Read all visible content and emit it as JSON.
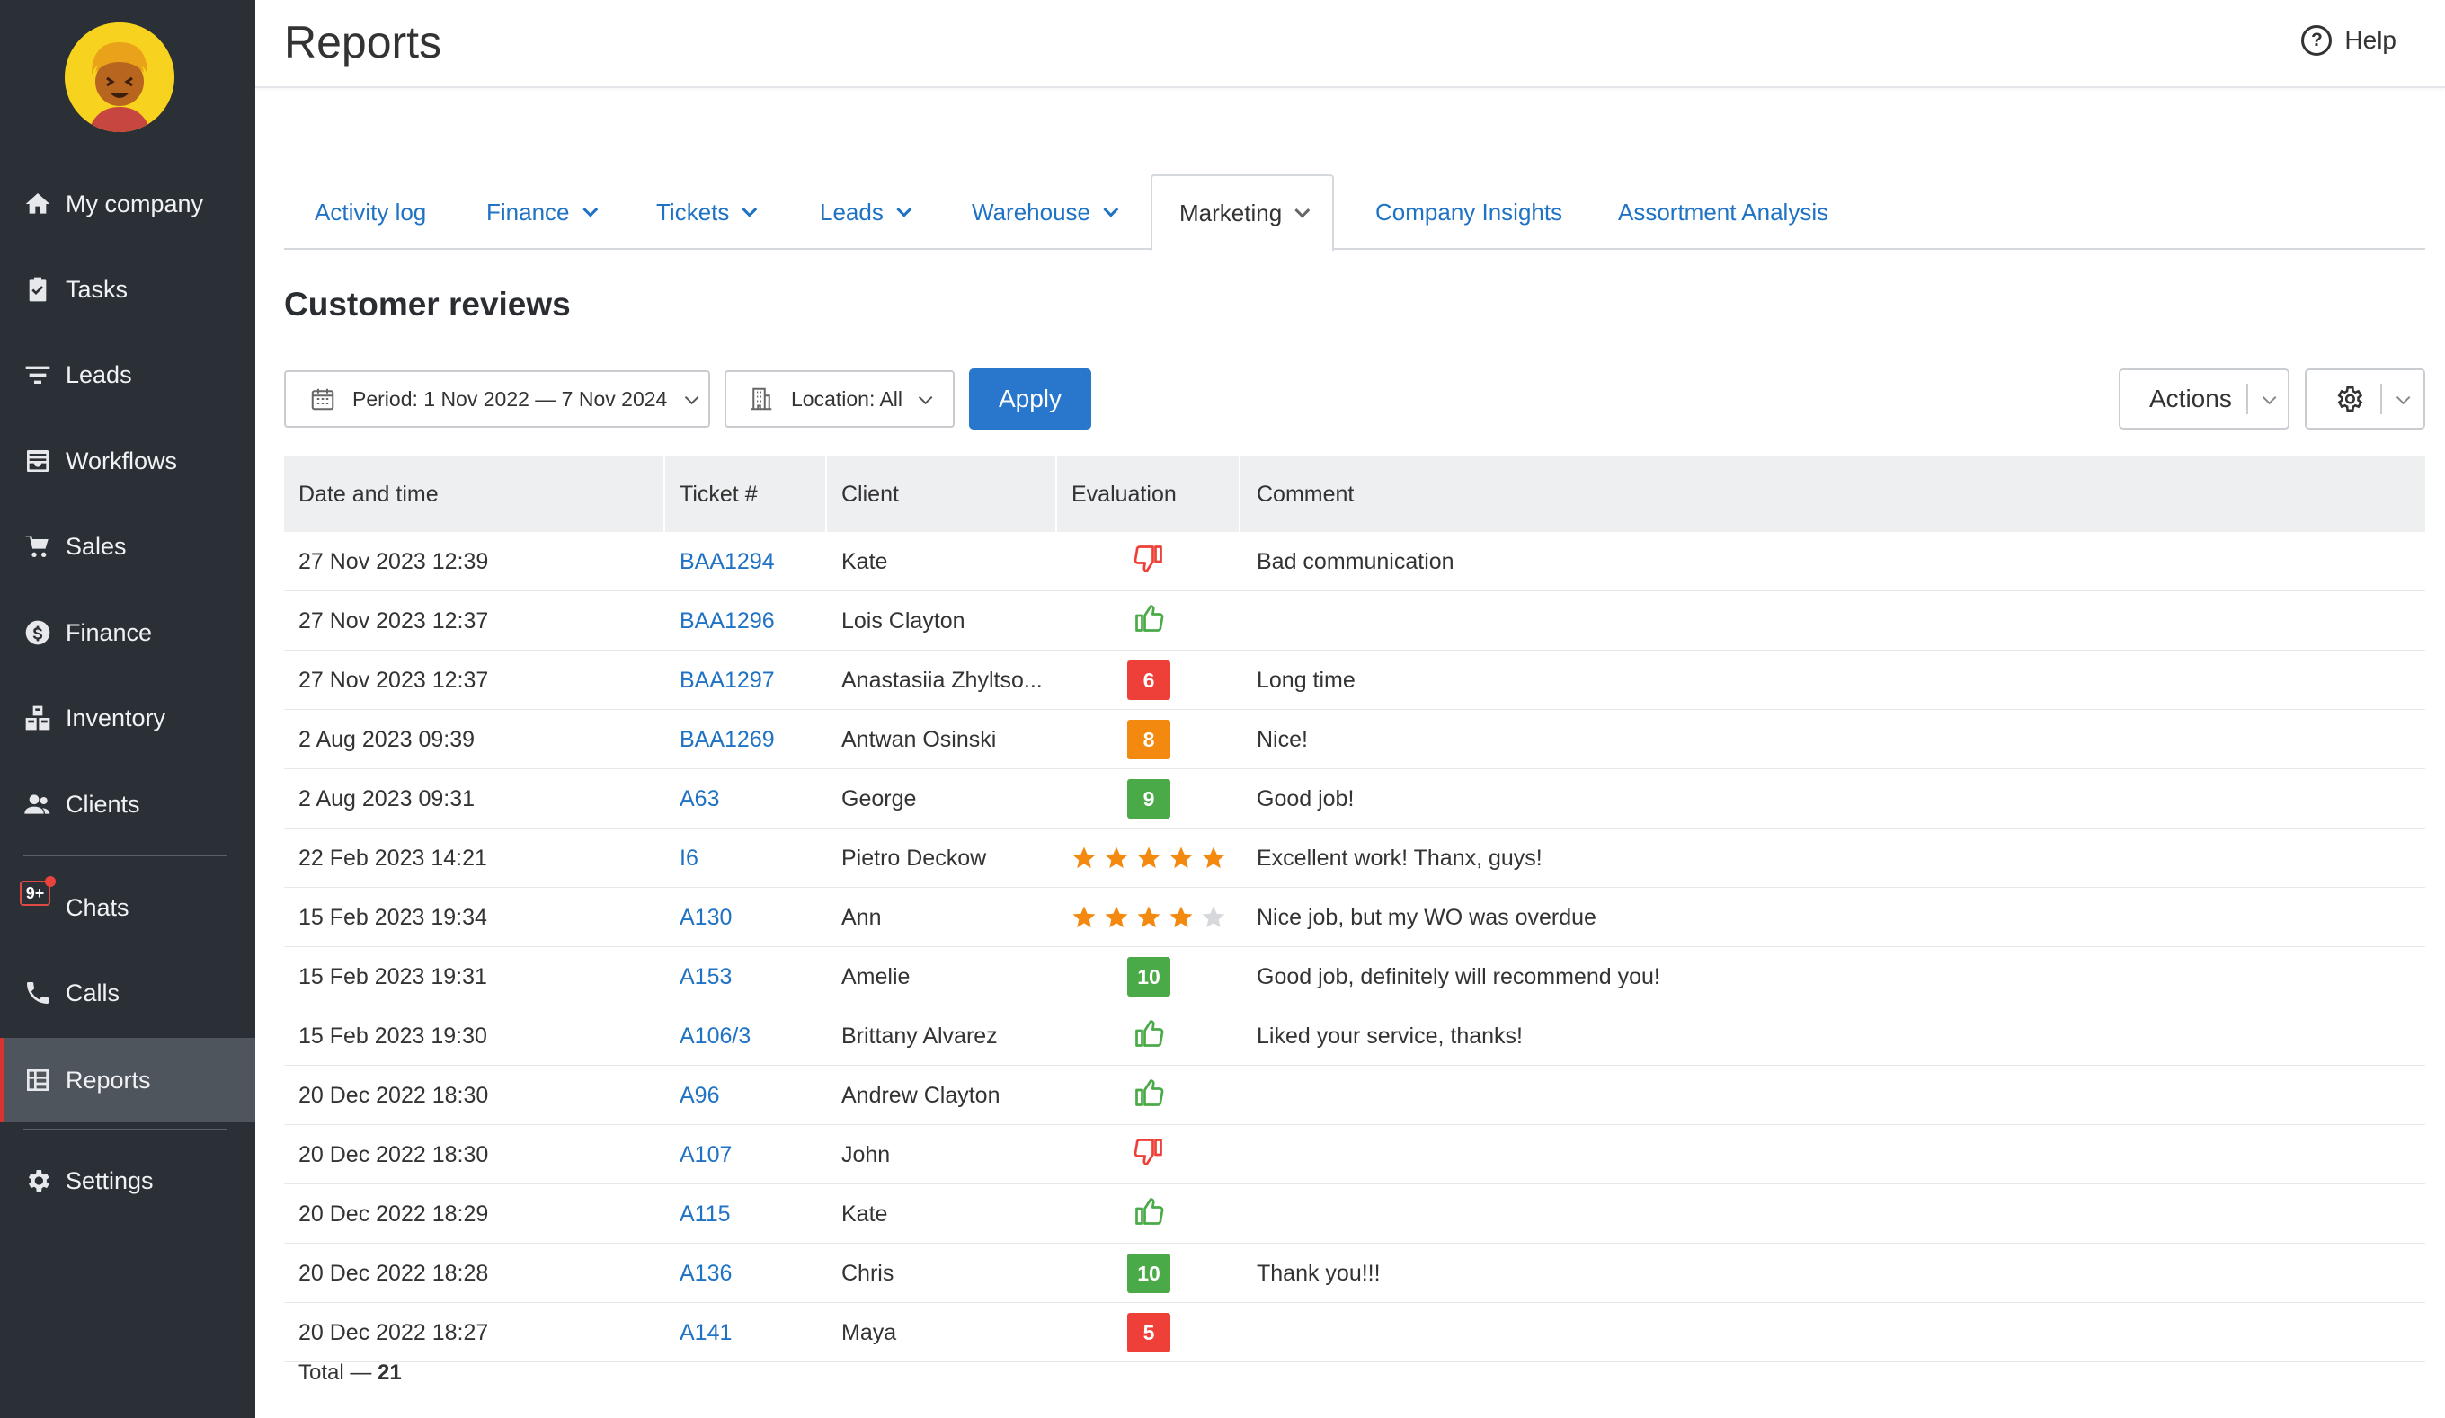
{
  "app": {
    "page_title": "Reports",
    "help_label": "Help"
  },
  "sidebar": {
    "items": [
      {
        "label": "My company",
        "icon": "home-icon"
      },
      {
        "label": "Tasks",
        "icon": "clipboard-check-icon"
      },
      {
        "label": "Leads",
        "icon": "funnel-icon"
      },
      {
        "label": "Workflows",
        "icon": "inbox-icon"
      },
      {
        "label": "Sales",
        "icon": "cart-icon"
      },
      {
        "label": "Finance",
        "icon": "dollar-coin-icon"
      },
      {
        "label": "Inventory",
        "icon": "boxes-icon"
      },
      {
        "label": "Clients",
        "icon": "users-icon"
      },
      {
        "label": "Chats",
        "icon": "chat-icon",
        "badge": "9+"
      },
      {
        "label": "Calls",
        "icon": "phone-icon"
      },
      {
        "label": "Reports",
        "icon": "grid-report-icon",
        "active": true
      },
      {
        "label": "Settings",
        "icon": "gear-icon"
      }
    ]
  },
  "tabs": [
    {
      "label": "Activity log",
      "dropdown": false
    },
    {
      "label": "Finance",
      "dropdown": true
    },
    {
      "label": "Tickets",
      "dropdown": true
    },
    {
      "label": "Leads",
      "dropdown": true
    },
    {
      "label": "Warehouse",
      "dropdown": true
    },
    {
      "label": "Marketing",
      "dropdown": true,
      "active": true
    },
    {
      "label": "Company Insights",
      "dropdown": false
    },
    {
      "label": "Assortment Analysis",
      "dropdown": false
    }
  ],
  "section": {
    "title": "Customer reviews"
  },
  "filters": {
    "period": "Period: 1 Nov 2022 — 7 Nov 2024",
    "location": "Location: All",
    "apply": "Apply",
    "actions": "Actions"
  },
  "table": {
    "columns": [
      "Date and time",
      "Ticket #",
      "Client",
      "Evaluation",
      "Comment"
    ],
    "rows": [
      {
        "date": "27 Nov 2023 12:39",
        "ticket": "BAA1294",
        "client": "Kate",
        "eval": {
          "type": "thumb",
          "value": "down"
        },
        "comment": "Bad communication"
      },
      {
        "date": "27 Nov 2023 12:37",
        "ticket": "BAA1296",
        "client": "Lois Clayton",
        "eval": {
          "type": "thumb",
          "value": "up"
        },
        "comment": ""
      },
      {
        "date": "27 Nov 2023 12:37",
        "ticket": "BAA1297",
        "client": "Anastasiia Zhyltso...",
        "eval": {
          "type": "score",
          "value": "6",
          "color": "#ee4038"
        },
        "comment": "Long time"
      },
      {
        "date": "2 Aug 2023 09:39",
        "ticket": "BAA1269",
        "client": "Antwan Osinski",
        "eval": {
          "type": "score",
          "value": "8",
          "color": "#f3890f"
        },
        "comment": "Nice!"
      },
      {
        "date": "2 Aug 2023 09:31",
        "ticket": "A63",
        "client": "George",
        "eval": {
          "type": "score",
          "value": "9",
          "color": "#4aaa47"
        },
        "comment": "Good job!"
      },
      {
        "date": "22 Feb 2023 14:21",
        "ticket": "I6",
        "client": "Pietro Deckow",
        "eval": {
          "type": "stars",
          "value": 5
        },
        "comment": "Excellent work! Thanx, guys!"
      },
      {
        "date": "15 Feb 2023 19:34",
        "ticket": "A130",
        "client": "Ann",
        "eval": {
          "type": "stars",
          "value": 4
        },
        "comment": "Nice job, but my WO was overdue"
      },
      {
        "date": "15 Feb 2023 19:31",
        "ticket": "A153",
        "client": "Amelie",
        "eval": {
          "type": "score",
          "value": "10",
          "color": "#4aaa47"
        },
        "comment": "Good job, definitely will recommend you!"
      },
      {
        "date": "15 Feb 2023 19:30",
        "ticket": "A106/3",
        "client": "Brittany Alvarez",
        "eval": {
          "type": "thumb",
          "value": "up"
        },
        "comment": "Liked your service, thanks!"
      },
      {
        "date": "20 Dec 2022 18:30",
        "ticket": "A96",
        "client": "Andrew Clayton",
        "eval": {
          "type": "thumb",
          "value": "up"
        },
        "comment": ""
      },
      {
        "date": "20 Dec 2022 18:30",
        "ticket": "A107",
        "client": "John",
        "eval": {
          "type": "thumb",
          "value": "down"
        },
        "comment": ""
      },
      {
        "date": "20 Dec 2022 18:29",
        "ticket": "A115",
        "client": "Kate",
        "eval": {
          "type": "thumb",
          "value": "up"
        },
        "comment": ""
      },
      {
        "date": "20 Dec 2022 18:28",
        "ticket": "A136",
        "client": "Chris",
        "eval": {
          "type": "score",
          "value": "10",
          "color": "#4aaa47"
        },
        "comment": "Thank you!!!"
      },
      {
        "date": "20 Dec 2022 18:27",
        "ticket": "A141",
        "client": "Maya",
        "eval": {
          "type": "score",
          "value": "5",
          "color": "#ee4038"
        },
        "comment": ""
      }
    ]
  },
  "footer": {
    "total_label": "Total — ",
    "total_value": "21"
  },
  "colors": {
    "sidebar_bg": "#2b3037",
    "accent": "#2877cc",
    "link": "#1f72c4",
    "thumb_up": "#4aaa47",
    "thumb_down": "#ee4038",
    "star": "#f3890f"
  }
}
